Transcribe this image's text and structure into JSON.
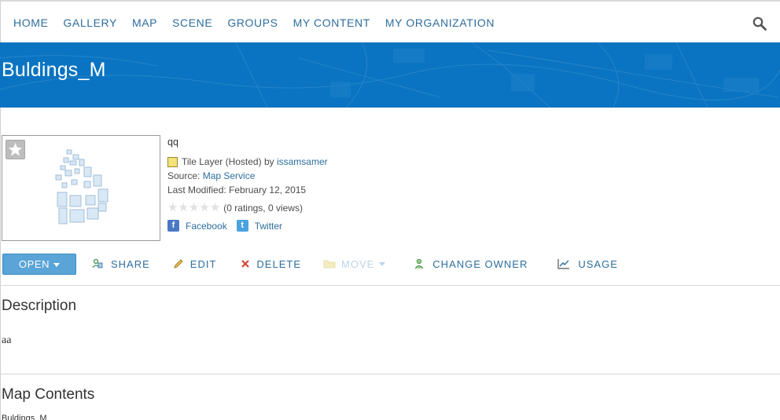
{
  "nav": {
    "items": [
      {
        "label": "HOME"
      },
      {
        "label": "GALLERY"
      },
      {
        "label": "MAP"
      },
      {
        "label": "SCENE"
      },
      {
        "label": "GROUPS"
      },
      {
        "label": "MY CONTENT"
      },
      {
        "label": "MY ORGANIZATION"
      }
    ],
    "search_icon": "search-icon"
  },
  "banner": {
    "title": "Buldings_M",
    "color": "#0a74c2"
  },
  "item": {
    "title": "qq",
    "type_text": "Tile Layer (Hosted)",
    "by_text": "by",
    "owner": "issamsamer",
    "source_label": "Source:",
    "source_value": "Map Service",
    "modified": "Last Modified: February 12, 2015",
    "ratings": "(0 ratings, 0 views)",
    "star_count": 5,
    "facebook": "Facebook",
    "twitter": "Twitter"
  },
  "actions": {
    "open": "OPEN",
    "share": "SHARE",
    "edit": "EDIT",
    "delete": "DELETE",
    "move": "MOVE",
    "change_owner": "CHANGE OWNER",
    "usage": "USAGE"
  },
  "description": {
    "heading": "Description",
    "text": "aa"
  },
  "map_contents": {
    "heading": "Map Contents",
    "text": "Buldings_M"
  }
}
